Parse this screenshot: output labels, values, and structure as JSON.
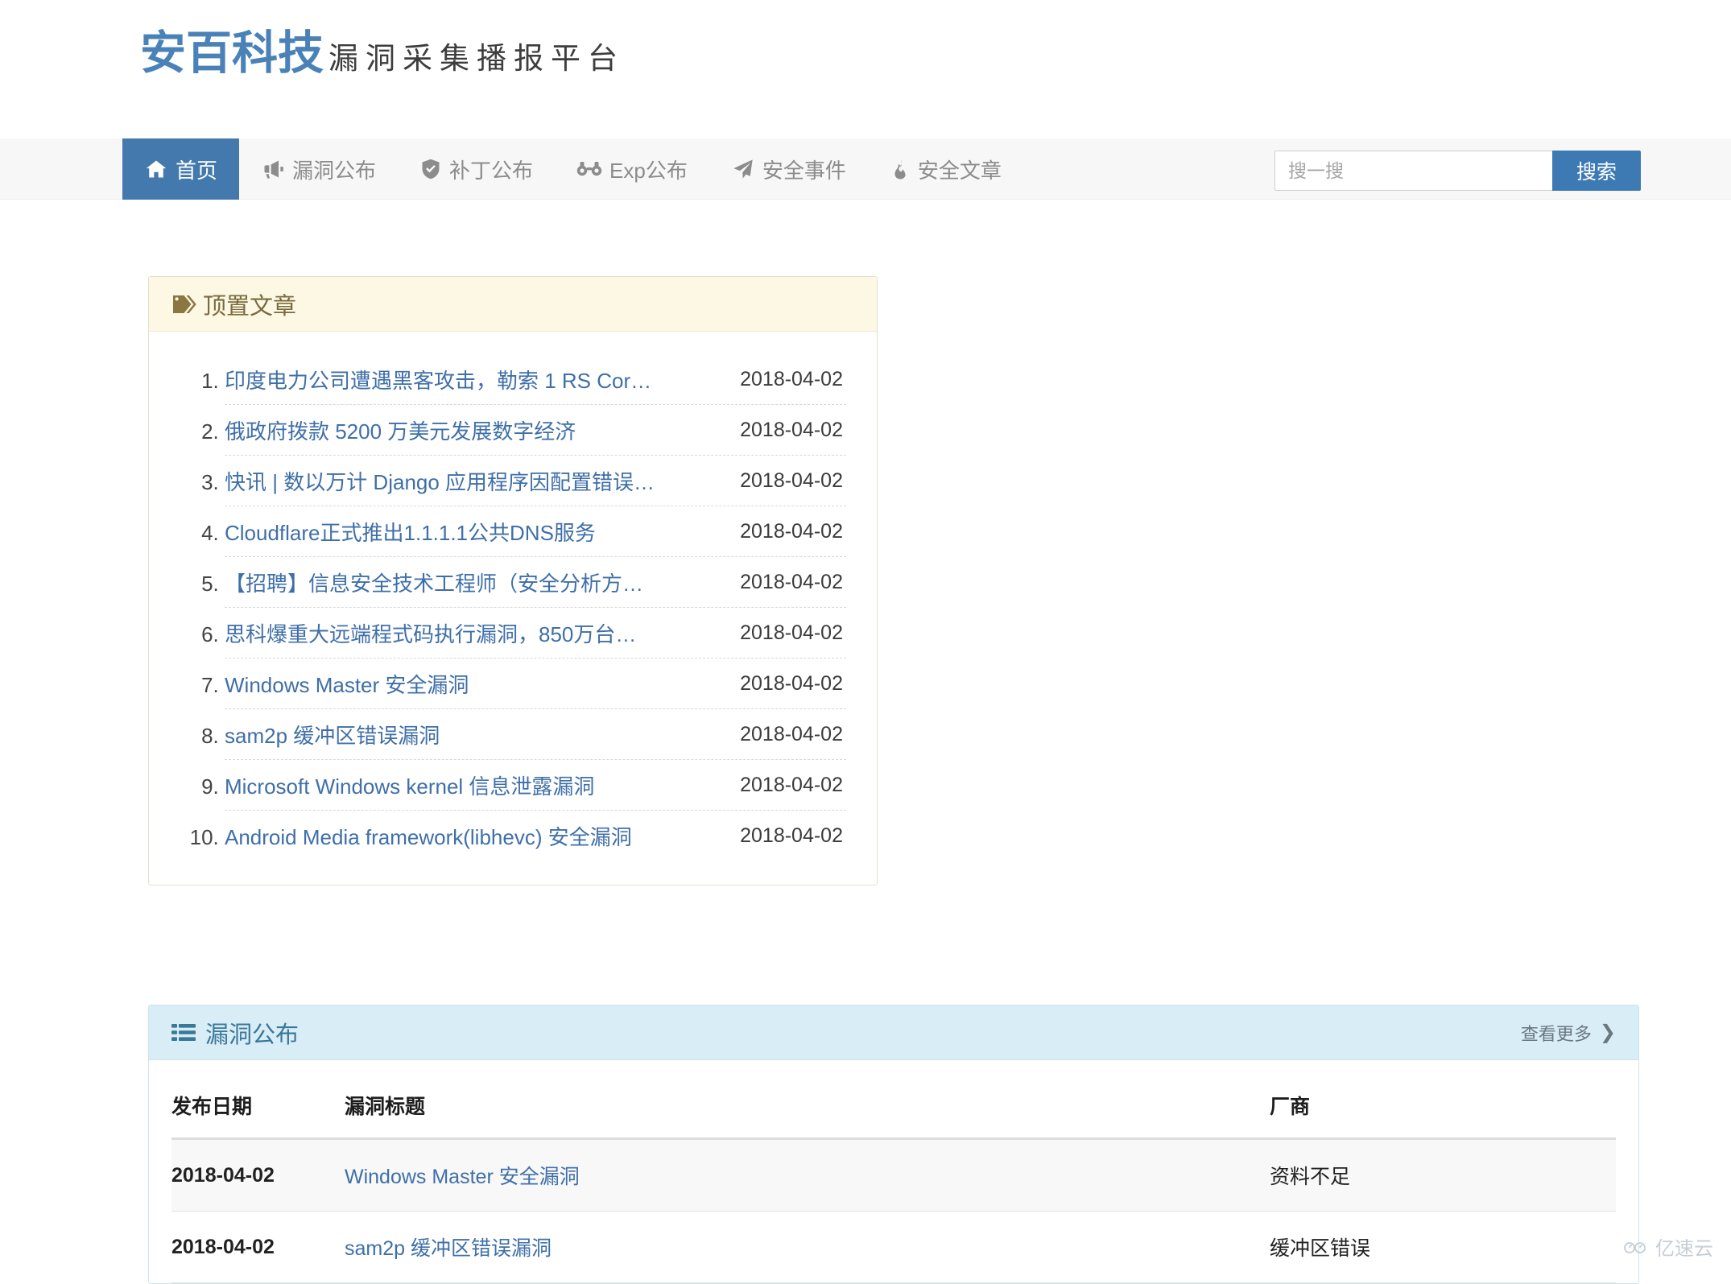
{
  "site": {
    "logo_main": "安百科技",
    "logo_sub": "漏洞采集播报平台",
    "brand_color": "#4a82b8",
    "active_nav_color": "#4479ae"
  },
  "nav": {
    "items": [
      {
        "label": "首页",
        "icon": "home-icon",
        "active": true
      },
      {
        "label": "漏洞公布",
        "icon": "bullhorn-icon",
        "active": false
      },
      {
        "label": "补丁公布",
        "icon": "check-shield-icon",
        "active": false
      },
      {
        "label": "Exp公布",
        "icon": "binoculars-icon",
        "active": false
      },
      {
        "label": "安全事件",
        "icon": "paper-plane-icon",
        "active": false
      },
      {
        "label": "安全文章",
        "icon": "fire-icon",
        "active": false
      }
    ]
  },
  "search": {
    "placeholder": "搜一搜",
    "value": "",
    "button_label": "搜索"
  },
  "top_articles": {
    "title": "顶置文章",
    "icon": "tag-icon",
    "items": [
      {
        "title": "印度电力公司遭遇黑客攻击，勒索 1 RS Cor…",
        "date": "2018-04-02"
      },
      {
        "title": "俄政府拨款 5200 万美元发展数字经济",
        "date": "2018-04-02"
      },
      {
        "title": "快讯 | 数以万计 Django 应用程序因配置错误…",
        "date": "2018-04-02"
      },
      {
        "title": "Cloudflare正式推出1.1.1.1公共DNS服务",
        "date": "2018-04-02"
      },
      {
        "title": "【招聘】信息安全技术工程师（安全分析方…",
        "date": "2018-04-02"
      },
      {
        "title": "思科爆重大远端程式码执行漏洞，850万台…",
        "date": "2018-04-02"
      },
      {
        "title": "Windows Master 安全漏洞",
        "date": "2018-04-02"
      },
      {
        "title": "sam2p 缓冲区错误漏洞",
        "date": "2018-04-02"
      },
      {
        "title": "Microsoft Windows kernel 信息泄露漏洞",
        "date": "2018-04-02"
      },
      {
        "title": "Android Media framework(libhevc) 安全漏洞",
        "date": "2018-04-02"
      }
    ]
  },
  "vuln_panel": {
    "title": "漏洞公布",
    "icon": "list-icon",
    "more_label": "查看更多",
    "more_chevron": "❯",
    "columns": [
      "发布日期",
      "漏洞标题",
      "厂商"
    ],
    "rows": [
      {
        "date": "2018-04-02",
        "title": "Windows Master 安全漏洞",
        "vendor": "资料不足"
      },
      {
        "date": "2018-04-02",
        "title": "sam2p 缓冲区错误漏洞",
        "vendor": "缓冲区错误"
      }
    ]
  },
  "watermark": {
    "label": "亿速云",
    "icon": "cloud-icon"
  }
}
